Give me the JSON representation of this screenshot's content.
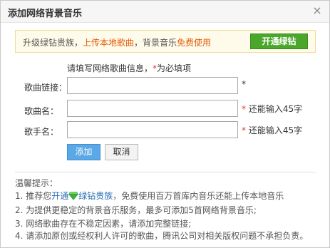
{
  "dialog": {
    "title": "添加网络背景音乐",
    "close_glyph": "×"
  },
  "promo": {
    "part1": "升级绿钻贵族，",
    "part2": "上传本地歌曲",
    "part3": "，背景音乐",
    "part4": "免费使用",
    "button_label": "开通绿钻"
  },
  "form": {
    "hint_prefix": "请填写网络歌曲信息，",
    "hint_star": "*",
    "hint_suffix": "为必填项",
    "song_link_label": "歌曲链接：",
    "song_link_value": "",
    "song_name_label": "歌曲名：",
    "song_name_value": "",
    "singer_label": "歌手名：",
    "singer_value": "",
    "required_star": "*",
    "limit_note": "还能输入45字",
    "add_button": "添加",
    "cancel_button": "取消"
  },
  "tips": {
    "title": "温馨提示：",
    "tip1_pre": "1. 推荐您",
    "tip1_link": "开通",
    "tip1_link2": "绿钻贵族",
    "tip1_post": "，免费使用百万首库内音乐还能上传本地音乐",
    "tip2": "2. 为提供更稳定的背景音乐服务，最多可添加5首网络背景音乐;",
    "tip3": "3. 网络歌曲存在不稳定因素，请添加完整链接;",
    "tip4": "4. 请添加原创或经权利人许可的歌曲，腾讯公司对相关版权问题不承担负责。"
  },
  "colors": {
    "accent_green": "#4aa72b",
    "accent_orange": "#e4590a",
    "required_red": "#e4393c",
    "link_blue": "#2a6fb6",
    "primary_blue": "#5aa8e6"
  },
  "icons": {
    "close": "close-icon",
    "green_diamond": "green-diamond-icon"
  }
}
